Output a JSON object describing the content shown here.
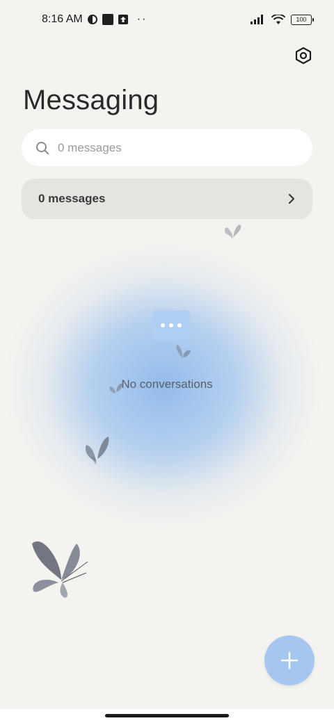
{
  "status_bar": {
    "time": "8:16 AM",
    "battery": "100",
    "icons": [
      "app-notification-icon",
      "square-notification-icon",
      "upload-icon",
      "more-dots-icon",
      "signal-icon",
      "wifi-icon",
      "battery-icon"
    ],
    "more": "··"
  },
  "header": {
    "title": "Messaging",
    "settings_icon": "settings-hexagon-icon"
  },
  "search": {
    "placeholder": "0 messages",
    "value": ""
  },
  "messages_card": {
    "label": "0 messages",
    "icon": "chevron-right-icon"
  },
  "empty_state": {
    "icon": "chat-bubble-icon",
    "text": "No conversations"
  },
  "fab": {
    "icon": "plus-icon",
    "color": "#a5c7ef"
  },
  "colors": {
    "background": "#f5f3ef",
    "accent_blue": "#8eb8ec",
    "card": "#e4e2de"
  }
}
